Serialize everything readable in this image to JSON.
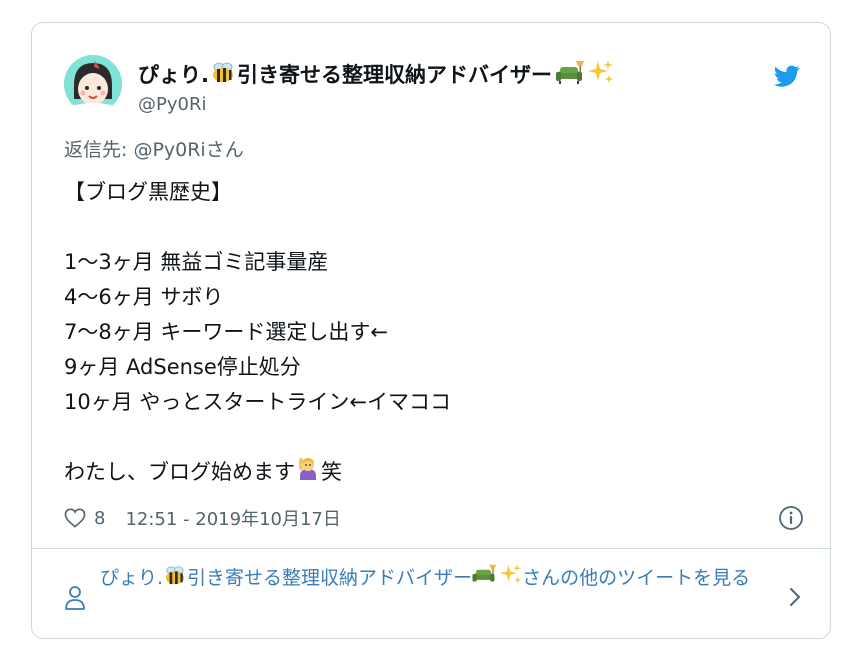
{
  "author": {
    "name": "ぴょり.",
    "name_suffix": "引き寄せる整理収納アドバイザー",
    "handle": "@Py0Ri"
  },
  "reply_to": "返信先: @Py0Riさん",
  "body_lines": {
    "l1": "【ブログ黒歴史】",
    "l2": "",
    "l3": "1〜3ヶ月  無益ゴミ記事量産",
    "l4": "4〜6ヶ月 サボり",
    "l5": "7〜8ヶ月  キーワード選定し出す←",
    "l6": "9ヶ月  AdSense停止処分",
    "l7": "10ヶ月  やっとスタートライン←イマココ",
    "l8": "",
    "l9_text": "わたし、ブログ始めます",
    "l9_tail": "笑"
  },
  "meta": {
    "like_count": "8",
    "timestamp": "12:51 - 2019年10月17日"
  },
  "footer": {
    "prefix": "ぴょり.",
    "middle": "引き寄せる整理収納アドバイザー",
    "suffix": "さんの他のツイートを見る"
  },
  "colors": {
    "text": "#0f1419",
    "muted": "#536471",
    "link": "#3b7cb8",
    "twitter_blue": "#1d9bf0",
    "border": "#cfd9de"
  },
  "icons": {
    "bird": "twitter-bird-icon",
    "heart": "heart-icon",
    "info": "info-icon",
    "person": "person-icon",
    "chevron": "chevron-right-icon"
  }
}
